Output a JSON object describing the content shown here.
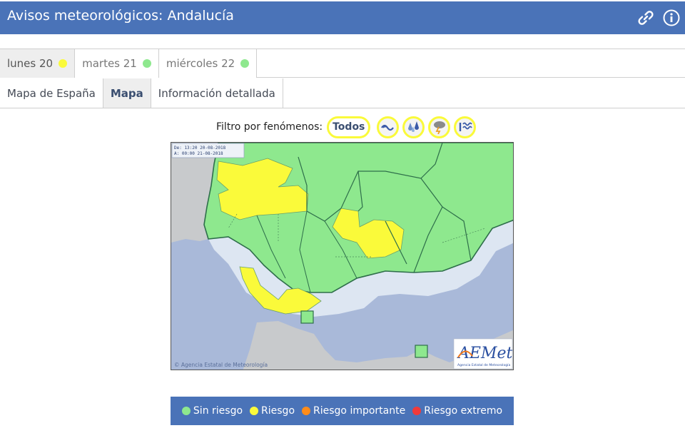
{
  "header": {
    "title": "Avisos meteorológicos: Andalucía",
    "link_icon": "link-icon",
    "info_icon": "info-icon"
  },
  "day_tabs": [
    {
      "label": "lunes 20",
      "status_color": "#fafa3a",
      "active": true
    },
    {
      "label": "martes 21",
      "status_color": "#8ee88e",
      "active": false
    },
    {
      "label": "miércoles 22",
      "status_color": "#8ee88e",
      "active": false
    }
  ],
  "view_tabs": [
    {
      "label": "Mapa de España",
      "active": false
    },
    {
      "label": "Mapa",
      "active": true
    },
    {
      "label": "Información detallada",
      "active": false
    }
  ],
  "filter": {
    "label": "Filtro por fenómenos:",
    "todos": "Todos",
    "icons": [
      "wind-icon",
      "rain-icon",
      "storm-icon",
      "coastal-icon"
    ]
  },
  "map": {
    "validity_from": "De: 13:20 20-08-2018",
    "validity_to": "A:  00:00 21-08-2018",
    "copyright": "© Agencia Estatal de Meteorología",
    "logo_text": "AEMet",
    "logo_subtext": "Agencia Estatal de Meteorología"
  },
  "legend": [
    {
      "label": "Sin riesgo",
      "color": "#8ee88e"
    },
    {
      "label": "Riesgo",
      "color": "#fafa3a"
    },
    {
      "label": "Riesgo importante",
      "color": "#ff8c1a"
    },
    {
      "label": "Riesgo extremo",
      "color": "#f03a3a"
    }
  ],
  "colors": {
    "header": "#4a73b8",
    "land_green": "#8ee88e",
    "warning_yellow": "#fafa3a",
    "sea": "#a9b9d9",
    "coastal_sea": "#dde6f2",
    "neighbour_land": "#c8cacc"
  }
}
